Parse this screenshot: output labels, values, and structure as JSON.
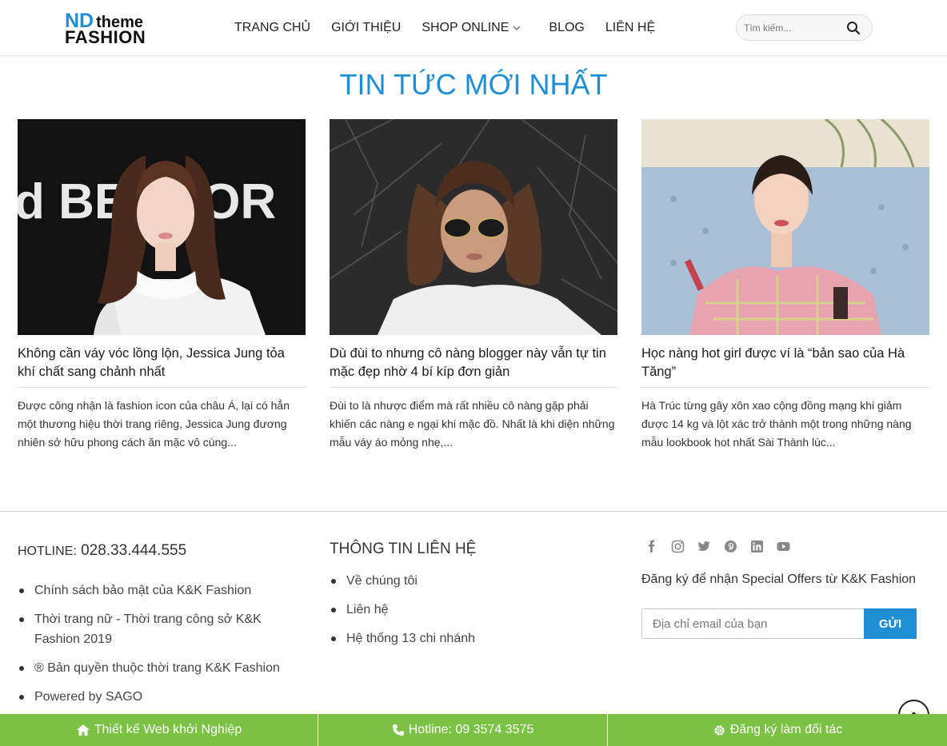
{
  "header": {
    "logo": {
      "nd": "ND",
      "theme": "theme",
      "fashion": "FASHION"
    },
    "nav": [
      {
        "label": "TRANG CHỦ"
      },
      {
        "label": "GIỚI THIỆU"
      },
      {
        "label": "SHOP ONLINE",
        "has_dropdown": true
      },
      {
        "label": "BLOG"
      },
      {
        "label": "LIÊN HỆ"
      }
    ],
    "search": {
      "placeholder": "Tìm kiếm...",
      "icon": "search-icon"
    }
  },
  "section_title": "TIN TỨC MỚI NHẤT",
  "posts": [
    {
      "title": "Không cần váy vóc lồng lộn, Jessica Jung tỏa khí chất sang chảnh nhất",
      "excerpt": "Được công nhận là fashion icon của châu Á, lại có hẳn một thương hiệu thời trang riêng, Jessica Jung đương nhiên sở hữu phong cách ăn mặc vô cùng...",
      "image_text": "d BERGOR"
    },
    {
      "title": "Dù đùi to nhưng cô nàng blogger này vẫn tự tin mặc đẹp nhờ 4 bí kíp đơn giản",
      "excerpt": "Đùi to là nhược điểm mà rất nhiều cô nàng gặp phải khiến các nàng e ngại khi mặc đồ. Nhất là khi diện những mẫu váy áo mỏng nhẹ,..."
    },
    {
      "title": "Học nàng hot girl được ví là “bản sao của Hà Tăng”",
      "excerpt": "Hà Trúc từng gây xôn xao cộng đồng mạng khi giảm được 14 kg và lột xác trở thành một trong những nàng mẫu lookbook hot nhất Sài Thành lúc..."
    }
  ],
  "footer": {
    "hotline_label": "HOTLINE:",
    "hotline_number": "028.33.444.555",
    "col1_links": [
      "Chính sách bảo mật của K&K Fashion",
      "Thời trang nữ - Thời trang công sở K&K Fashion 2019",
      "® Bản quyền thuộc thời trang K&K Fashion",
      "Powered by SAGO"
    ],
    "col2_title": "THÔNG TIN LIÊN HỆ",
    "col2_links": [
      "Về chúng tôi",
      "Liên hệ",
      "Hệ thống 13 chi nhánh"
    ],
    "social_icons": [
      "facebook-icon",
      "instagram-icon",
      "twitter-icon",
      "pinterest-icon",
      "linkedin-icon",
      "youtube-icon"
    ],
    "signup_text": "Đăng ký để nhận Special Offers từ K&K Fashion",
    "email_placeholder": "Địa chỉ email của bạn",
    "send_label": "GỬI"
  },
  "bottom_bar": [
    {
      "label": "Thiết kế Web khởi Nghiệp",
      "icon": "home-icon"
    },
    {
      "label": "Hotline: 09 3574 3575",
      "icon": "phone-icon"
    },
    {
      "label": "Đăng ký làm đối tác",
      "icon": "gear-icon"
    }
  ],
  "colors": {
    "accent": "#1e8fd5",
    "bottom_bar": "#7ac144",
    "text": "#333333"
  }
}
